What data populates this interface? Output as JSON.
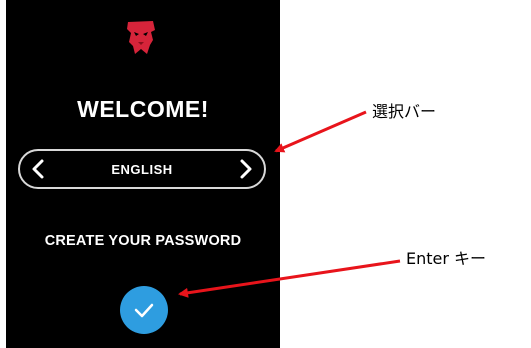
{
  "device": {
    "logo_icon": "kingston-logo-icon",
    "welcome_text": "WELCOME!",
    "language_selector": {
      "value": "ENGLISH",
      "prev_icon": "chevron-left-icon",
      "next_icon": "chevron-right-icon"
    },
    "prompt_text": "CREATE YOUR PASSWORD",
    "enter_button_icon": "checkmark-icon"
  },
  "annotations": {
    "selector_bar_label": "選択バー",
    "enter_key_label": "Enter キー"
  },
  "colors": {
    "screen_bg": "#000000",
    "text": "#ffffff",
    "accent_blue": "#2e9de0",
    "logo_red": "#d6243a",
    "arrow_red": "#e8141b"
  }
}
